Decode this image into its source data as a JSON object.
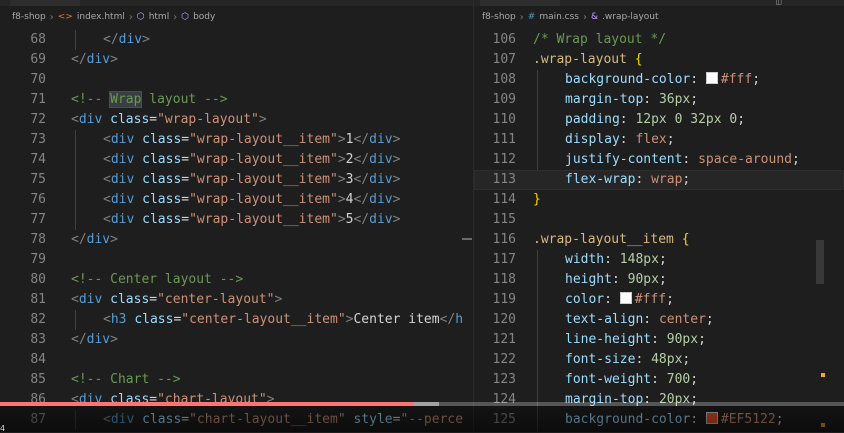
{
  "left": {
    "tab_label": "index.html",
    "breadcrumb": [
      "f8-shop",
      "index.html",
      "html",
      "body"
    ],
    "lines": [
      {
        "n": "68",
        "indent": 1,
        "tokens": [
          [
            "t-punc",
            "</"
          ],
          [
            "t-tag",
            "div"
          ],
          [
            "t-punc",
            ">"
          ]
        ]
      },
      {
        "n": "69",
        "indent": 0,
        "tokens": [
          [
            "t-punc",
            "</"
          ],
          [
            "t-tag",
            "div"
          ],
          [
            "t-punc",
            ">"
          ]
        ]
      },
      {
        "n": "70",
        "indent": 0,
        "tokens": []
      },
      {
        "n": "71",
        "indent": 0,
        "tokens": [
          [
            "t-cmt",
            "<!-- "
          ],
          [
            "t-cmt word-hl",
            "Wrap"
          ],
          [
            "t-cmt",
            " layout -->"
          ]
        ]
      },
      {
        "n": "72",
        "indent": 0,
        "tokens": [
          [
            "t-punc",
            "<"
          ],
          [
            "t-tag",
            "div"
          ],
          [
            "t-text",
            " "
          ],
          [
            "t-attr",
            "class"
          ],
          [
            "t-text",
            "="
          ],
          [
            "t-str",
            "\"wrap-layout\""
          ],
          [
            "t-punc",
            ">"
          ]
        ]
      },
      {
        "n": "73",
        "indent": 1,
        "tokens": [
          [
            "t-punc",
            "<"
          ],
          [
            "t-tag",
            "div"
          ],
          [
            "t-text",
            " "
          ],
          [
            "t-attr",
            "class"
          ],
          [
            "t-text",
            "="
          ],
          [
            "t-str",
            "\"wrap-layout__item\""
          ],
          [
            "t-punc",
            ">"
          ],
          [
            "t-text",
            "1"
          ],
          [
            "t-punc",
            "</"
          ],
          [
            "t-tag",
            "div"
          ],
          [
            "t-punc",
            ">"
          ]
        ]
      },
      {
        "n": "74",
        "indent": 1,
        "tokens": [
          [
            "t-punc",
            "<"
          ],
          [
            "t-tag",
            "div"
          ],
          [
            "t-text",
            " "
          ],
          [
            "t-attr",
            "class"
          ],
          [
            "t-text",
            "="
          ],
          [
            "t-str",
            "\"wrap-layout__item\""
          ],
          [
            "t-punc",
            ">"
          ],
          [
            "t-text",
            "2"
          ],
          [
            "t-punc",
            "</"
          ],
          [
            "t-tag",
            "div"
          ],
          [
            "t-punc",
            ">"
          ]
        ]
      },
      {
        "n": "75",
        "indent": 1,
        "tokens": [
          [
            "t-punc",
            "<"
          ],
          [
            "t-tag",
            "div"
          ],
          [
            "t-text",
            " "
          ],
          [
            "t-attr",
            "class"
          ],
          [
            "t-text",
            "="
          ],
          [
            "t-str",
            "\"wrap-layout__item\""
          ],
          [
            "t-punc",
            ">"
          ],
          [
            "t-text",
            "3"
          ],
          [
            "t-punc",
            "</"
          ],
          [
            "t-tag",
            "div"
          ],
          [
            "t-punc",
            ">"
          ]
        ]
      },
      {
        "n": "76",
        "indent": 1,
        "tokens": [
          [
            "t-punc",
            "<"
          ],
          [
            "t-tag",
            "div"
          ],
          [
            "t-text",
            " "
          ],
          [
            "t-attr",
            "class"
          ],
          [
            "t-text",
            "="
          ],
          [
            "t-str",
            "\"wrap-layout__item\""
          ],
          [
            "t-punc",
            ">"
          ],
          [
            "t-text",
            "4"
          ],
          [
            "t-punc",
            "</"
          ],
          [
            "t-tag",
            "div"
          ],
          [
            "t-punc",
            ">"
          ]
        ]
      },
      {
        "n": "77",
        "indent": 1,
        "tokens": [
          [
            "t-punc",
            "<"
          ],
          [
            "t-tag",
            "div"
          ],
          [
            "t-text",
            " "
          ],
          [
            "t-attr",
            "class"
          ],
          [
            "t-text",
            "="
          ],
          [
            "t-str",
            "\"wrap-layout__item\""
          ],
          [
            "t-punc",
            ">"
          ],
          [
            "t-text",
            "5"
          ],
          [
            "t-punc",
            "</"
          ],
          [
            "t-tag",
            "div"
          ],
          [
            "t-punc",
            ">"
          ]
        ]
      },
      {
        "n": "78",
        "indent": 0,
        "tokens": [
          [
            "t-punc",
            "</"
          ],
          [
            "t-tag",
            "div"
          ],
          [
            "t-punc",
            ">"
          ]
        ]
      },
      {
        "n": "79",
        "indent": 0,
        "tokens": []
      },
      {
        "n": "80",
        "indent": 0,
        "tokens": [
          [
            "t-cmt",
            "<!-- Center layout -->"
          ]
        ]
      },
      {
        "n": "81",
        "indent": 0,
        "tokens": [
          [
            "t-punc",
            "<"
          ],
          [
            "t-tag",
            "div"
          ],
          [
            "t-text",
            " "
          ],
          [
            "t-attr",
            "class"
          ],
          [
            "t-text",
            "="
          ],
          [
            "t-str",
            "\"center-layout\""
          ],
          [
            "t-punc",
            ">"
          ]
        ]
      },
      {
        "n": "82",
        "indent": 1,
        "tokens": [
          [
            "t-punc",
            "<"
          ],
          [
            "t-tag",
            "h3"
          ],
          [
            "t-text",
            " "
          ],
          [
            "t-attr",
            "class"
          ],
          [
            "t-text",
            "="
          ],
          [
            "t-str",
            "\"center-layout__item\""
          ],
          [
            "t-punc",
            ">"
          ],
          [
            "t-text",
            "Center item"
          ],
          [
            "t-punc",
            "</"
          ],
          [
            "t-tag",
            "h"
          ]
        ]
      },
      {
        "n": "83",
        "indent": 0,
        "tokens": [
          [
            "t-punc",
            "</"
          ],
          [
            "t-tag",
            "div"
          ],
          [
            "t-punc",
            ">"
          ]
        ]
      },
      {
        "n": "84",
        "indent": 0,
        "tokens": []
      },
      {
        "n": "85",
        "indent": 0,
        "tokens": [
          [
            "t-cmt",
            "<!-- Chart -->"
          ]
        ]
      },
      {
        "n": "86",
        "indent": 0,
        "tokens": [
          [
            "t-punc",
            "<"
          ],
          [
            "t-tag",
            "div"
          ],
          [
            "t-text",
            " "
          ],
          [
            "t-attr",
            "class"
          ],
          [
            "t-text",
            "="
          ],
          [
            "t-str",
            "\"chart-layout\""
          ],
          [
            "t-punc",
            ">"
          ]
        ]
      },
      {
        "n": "87",
        "indent": 1,
        "tokens": [
          [
            "t-punc",
            "<"
          ],
          [
            "t-tag",
            "div"
          ],
          [
            "t-text",
            " "
          ],
          [
            "t-attr",
            "class"
          ],
          [
            "t-text",
            "="
          ],
          [
            "t-str",
            "\"chart-layout__item\""
          ],
          [
            "t-text",
            " "
          ],
          [
            "t-attr",
            "style"
          ],
          [
            "t-text",
            "="
          ],
          [
            "t-str",
            "\"--perce"
          ]
        ]
      }
    ]
  },
  "right": {
    "tab_label": "main.css",
    "breadcrumb": [
      "f8-shop",
      "main.css",
      ".wrap-layout"
    ],
    "lines": [
      {
        "n": "106",
        "indent": 0,
        "tokens": [
          [
            "t-cmt",
            "/* Wrap layout */"
          ]
        ]
      },
      {
        "n": "107",
        "indent": 0,
        "tokens": [
          [
            "t-sel",
            ".wrap-layout"
          ],
          [
            "t-text",
            " "
          ],
          [
            "t-brace",
            "{"
          ]
        ]
      },
      {
        "n": "108",
        "indent": 1,
        "tokens": [
          [
            "t-prop",
            "background-color"
          ],
          [
            "t-text",
            ": "
          ],
          [
            "swatch",
            "#ffffff"
          ],
          [
            "t-val",
            "#fff"
          ],
          [
            "t-text",
            ";"
          ]
        ]
      },
      {
        "n": "109",
        "indent": 1,
        "tokens": [
          [
            "t-prop",
            "margin-top"
          ],
          [
            "t-text",
            ": "
          ],
          [
            "t-num",
            "36px"
          ],
          [
            "t-text",
            ";"
          ]
        ]
      },
      {
        "n": "110",
        "indent": 1,
        "tokens": [
          [
            "t-prop",
            "padding"
          ],
          [
            "t-text",
            ": "
          ],
          [
            "t-num",
            "12px 0 32px 0"
          ],
          [
            "t-text",
            ";"
          ]
        ]
      },
      {
        "n": "111",
        "indent": 1,
        "tokens": [
          [
            "t-prop",
            "display"
          ],
          [
            "t-text",
            ": "
          ],
          [
            "t-val",
            "flex"
          ],
          [
            "t-text",
            ";"
          ]
        ]
      },
      {
        "n": "112",
        "indent": 1,
        "tokens": [
          [
            "t-prop",
            "justify-content"
          ],
          [
            "t-text",
            ": "
          ],
          [
            "t-val",
            "space-around"
          ],
          [
            "t-text",
            ";"
          ]
        ]
      },
      {
        "n": "113",
        "indent": 1,
        "tokens": [
          [
            "t-prop",
            "flex-wrap"
          ],
          [
            "t-text",
            ": "
          ],
          [
            "t-val",
            "wrap"
          ],
          [
            "t-text",
            ";"
          ]
        ]
      },
      {
        "n": "114",
        "indent": 0,
        "tokens": [
          [
            "t-brace",
            "}"
          ]
        ]
      },
      {
        "n": "115",
        "indent": 0,
        "tokens": []
      },
      {
        "n": "116",
        "indent": 0,
        "tokens": [
          [
            "t-sel",
            ".wrap-layout__item"
          ],
          [
            "t-text",
            " "
          ],
          [
            "t-brace",
            "{"
          ]
        ]
      },
      {
        "n": "117",
        "indent": 1,
        "tokens": [
          [
            "t-prop",
            "width"
          ],
          [
            "t-text",
            ": "
          ],
          [
            "t-num",
            "148px"
          ],
          [
            "t-text",
            ";"
          ]
        ]
      },
      {
        "n": "118",
        "indent": 1,
        "tokens": [
          [
            "t-prop",
            "height"
          ],
          [
            "t-text",
            ": "
          ],
          [
            "t-num",
            "90px"
          ],
          [
            "t-text",
            ";"
          ]
        ]
      },
      {
        "n": "119",
        "indent": 1,
        "tokens": [
          [
            "t-prop",
            "color"
          ],
          [
            "t-text",
            ": "
          ],
          [
            "swatch",
            "#ffffff"
          ],
          [
            "t-val",
            "#fff"
          ],
          [
            "t-text",
            ";"
          ]
        ]
      },
      {
        "n": "120",
        "indent": 1,
        "tokens": [
          [
            "t-prop",
            "text-align"
          ],
          [
            "t-text",
            ": "
          ],
          [
            "t-val",
            "center"
          ],
          [
            "t-text",
            ";"
          ]
        ]
      },
      {
        "n": "121",
        "indent": 1,
        "tokens": [
          [
            "t-prop",
            "line-height"
          ],
          [
            "t-text",
            ": "
          ],
          [
            "t-num",
            "90px"
          ],
          [
            "t-text",
            ";"
          ]
        ]
      },
      {
        "n": "122",
        "indent": 1,
        "tokens": [
          [
            "t-prop",
            "font-size"
          ],
          [
            "t-text",
            ": "
          ],
          [
            "t-num",
            "48px"
          ],
          [
            "t-text",
            ";"
          ]
        ]
      },
      {
        "n": "123",
        "indent": 1,
        "tokens": [
          [
            "t-prop",
            "font-weight"
          ],
          [
            "t-text",
            ": "
          ],
          [
            "t-num",
            "700"
          ],
          [
            "t-text",
            ";"
          ]
        ]
      },
      {
        "n": "124",
        "indent": 1,
        "tokens": [
          [
            "t-prop",
            "margin-top"
          ],
          [
            "t-text",
            ": "
          ],
          [
            "t-num",
            "20px"
          ],
          [
            "t-text",
            ";"
          ]
        ]
      },
      {
        "n": "125",
        "indent": 1,
        "tokens": [
          [
            "t-prop",
            "background-color"
          ],
          [
            "t-text",
            ": "
          ],
          [
            "swatch",
            "#EF5122"
          ],
          [
            "t-val",
            "#EF5122"
          ],
          [
            "t-text",
            ";"
          ]
        ]
      }
    ]
  },
  "video": {
    "progress": 0.49,
    "corner_label": "4"
  },
  "colors": {
    "editor_bg": "#1e1e1e",
    "progress_fill": "#ff0000"
  }
}
